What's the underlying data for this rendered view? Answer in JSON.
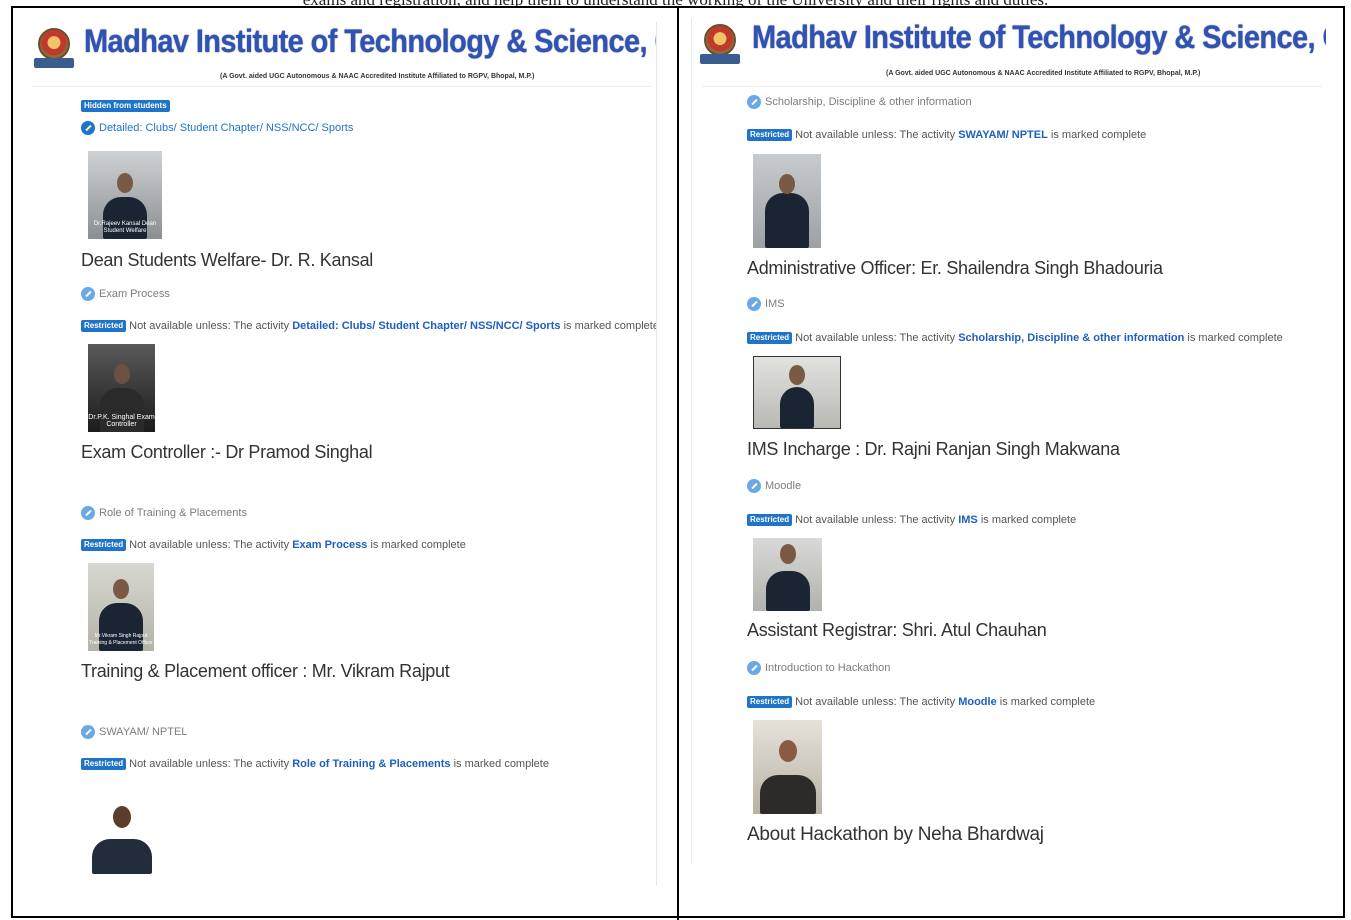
{
  "top_fragment": "exams and registration, and help them to understand the working of the University and their rights and duties.",
  "colors": {
    "brand": "#2f52b3",
    "link": "#1f5fbf",
    "badge": "#1f73c8"
  },
  "left": {
    "institute_name": "Madhav Institute of Technology & Science, Gwalior",
    "institute_sub": "(A Govt. aided UGC Autonomous & NAAC Accredited Institute Affiliated to RGPV, Bhopal, M.P.)",
    "hidden_badge": "Hidden from students",
    "act_clubs": "Detailed: Clubs/ Student Chapter/ NSS/NCC/ Sports",
    "photo1_caption": "Dr.Rajeev Kansal Dean Student Welfare",
    "dean_heading": "Dean Students Welfare-  Dr. R. Kansal",
    "act_exam": "Exam Process",
    "restricted": "Restricted",
    "not_avail": "Not available unless: The activity",
    "marked_complete": "is marked complete",
    "r1_link": "Detailed: Clubs/ Student Chapter/ NSS/NCC/ Sports",
    "photo2_caption": "Dr.P.K. Singhal Exam Controller",
    "exam_heading": "Exam Controller :- Dr Pramod Singhal",
    "act_training": "Role of Training & Placements",
    "r2_link": "Exam Process",
    "photo3_caption": "Mr.Vikram Singh Rajput Training & Placement Officer",
    "tpo_heading": "Training & Placement officer : Mr. Vikram Rajput",
    "act_swayam": "SWAYAM/ NPTEL",
    "r3_link": "Role of Training & Placements"
  },
  "right": {
    "institute_name": "Madhav Institute of Technology & Science, Gwalior",
    "institute_sub": "(A Govt. aided UGC Autonomous & NAAC Accredited Institute Affiliated to RGPV, Bhopal, M.P.)",
    "act_scholarship": "Scholarship, Discipline & other information",
    "restricted": "Restricted",
    "not_avail": "Not available unless: The activity",
    "marked_complete": "is marked complete",
    "r1_link": "SWAYAM/ NPTEL",
    "ao_heading": "Administrative Officer:  Er. Shailendra Singh Bhadouria",
    "act_ims": "IMS",
    "r2_link": "Scholarship, Discipline & other information",
    "ims_heading": "IMS Incharge : Dr. Rajni Ranjan Singh Makwana",
    "act_moodle": "Moodle",
    "r3_link": "IMS",
    "ar_heading": "Assistant Registrar:  Shri. Atul Chauhan",
    "act_hackathon": "Introduction to Hackathon",
    "r4_link": "Moodle",
    "hack_heading": "About Hackathon by Neha Bhardwaj"
  }
}
